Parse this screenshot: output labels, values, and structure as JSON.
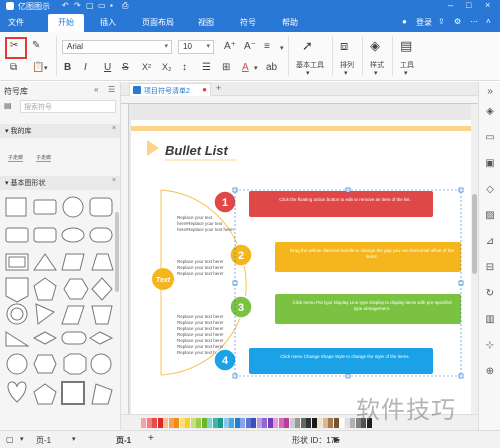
{
  "titlebar": {
    "app_title": "亿图图示"
  },
  "menu": {
    "tabs": [
      "文件",
      "开始",
      "插入",
      "页面布局",
      "视图",
      "符号",
      "帮助"
    ],
    "login": "登录"
  },
  "ribbon": {
    "font_name": "Arial",
    "font_size": "10",
    "groups": {
      "basic_tools": "基本工具",
      "arrange": "排列",
      "style": "样式",
      "tools": "工具"
    }
  },
  "left_panel": {
    "title": "符号库",
    "search_placeholder": "搜索符号",
    "my_library": "我的库",
    "library_items": [
      "子走廊",
      "子走廊"
    ],
    "basic_shapes": "基本图形状"
  },
  "doc_tab": {
    "label": "项目符号清单2"
  },
  "diagram": {
    "title": "Bullet List",
    "center_label": "Text",
    "side_texts": [
      "Replace your text here!Replace your text here!Replace your text here!",
      "Replace your text here! Replace your text here! Replace your text here!",
      "Replace your text here! Replace your text here! Replace your text here! Replace your text here! Replace your text here! Replace your text here! Replace your text here!"
    ],
    "items": [
      {
        "number": "1",
        "color": "#e04848",
        "text": "Click the floating action button to edit or remove an item of the list."
      },
      {
        "number": "2",
        "color": "#f5b51d",
        "text": "Drag the yellow diamond handle to change the gap you use horizontal offset of the items."
      },
      {
        "number": "3",
        "color": "#7cc242",
        "text": "Click menu Put type Display Line type Display to display items with pre-specifed type arrangement."
      },
      {
        "number": "4",
        "color": "#1aa1e6",
        "text": "Click menu Change Shape Style to change the style of the items."
      }
    ]
  },
  "palette_colors": [
    "#f6a3a3",
    "#f27d7d",
    "#e84a4a",
    "#d92b2b",
    "#f7c28c",
    "#f5a24c",
    "#f08a1a",
    "#f8e07a",
    "#f5cf2a",
    "#c6e17d",
    "#9ccd4a",
    "#6bb52a",
    "#84d3c8",
    "#3db8a6",
    "#1b9a8a",
    "#8dc9ef",
    "#4aa7e6",
    "#1f7fd1",
    "#8aa2e6",
    "#5a74d6",
    "#3a4fb8",
    "#b89be6",
    "#9266d6",
    "#6f3db8",
    "#e69bd6",
    "#d866bd",
    "#b83d9a",
    "#cccccc",
    "#999999",
    "#666666",
    "#333333",
    "#1a1a1a",
    "#f2e0c8",
    "#d9b98c",
    "#a67a4a",
    "#7a5230",
    "#ffffff",
    "#e0e0e0",
    "#b0b0b0",
    "#808080",
    "#505050",
    "#202020"
  ],
  "statusbar": {
    "page_tab_1": "页-1",
    "page_tab_2": "页-1",
    "add": "+",
    "shape_id": "形状 ID：175"
  },
  "watermark": "软件技巧"
}
